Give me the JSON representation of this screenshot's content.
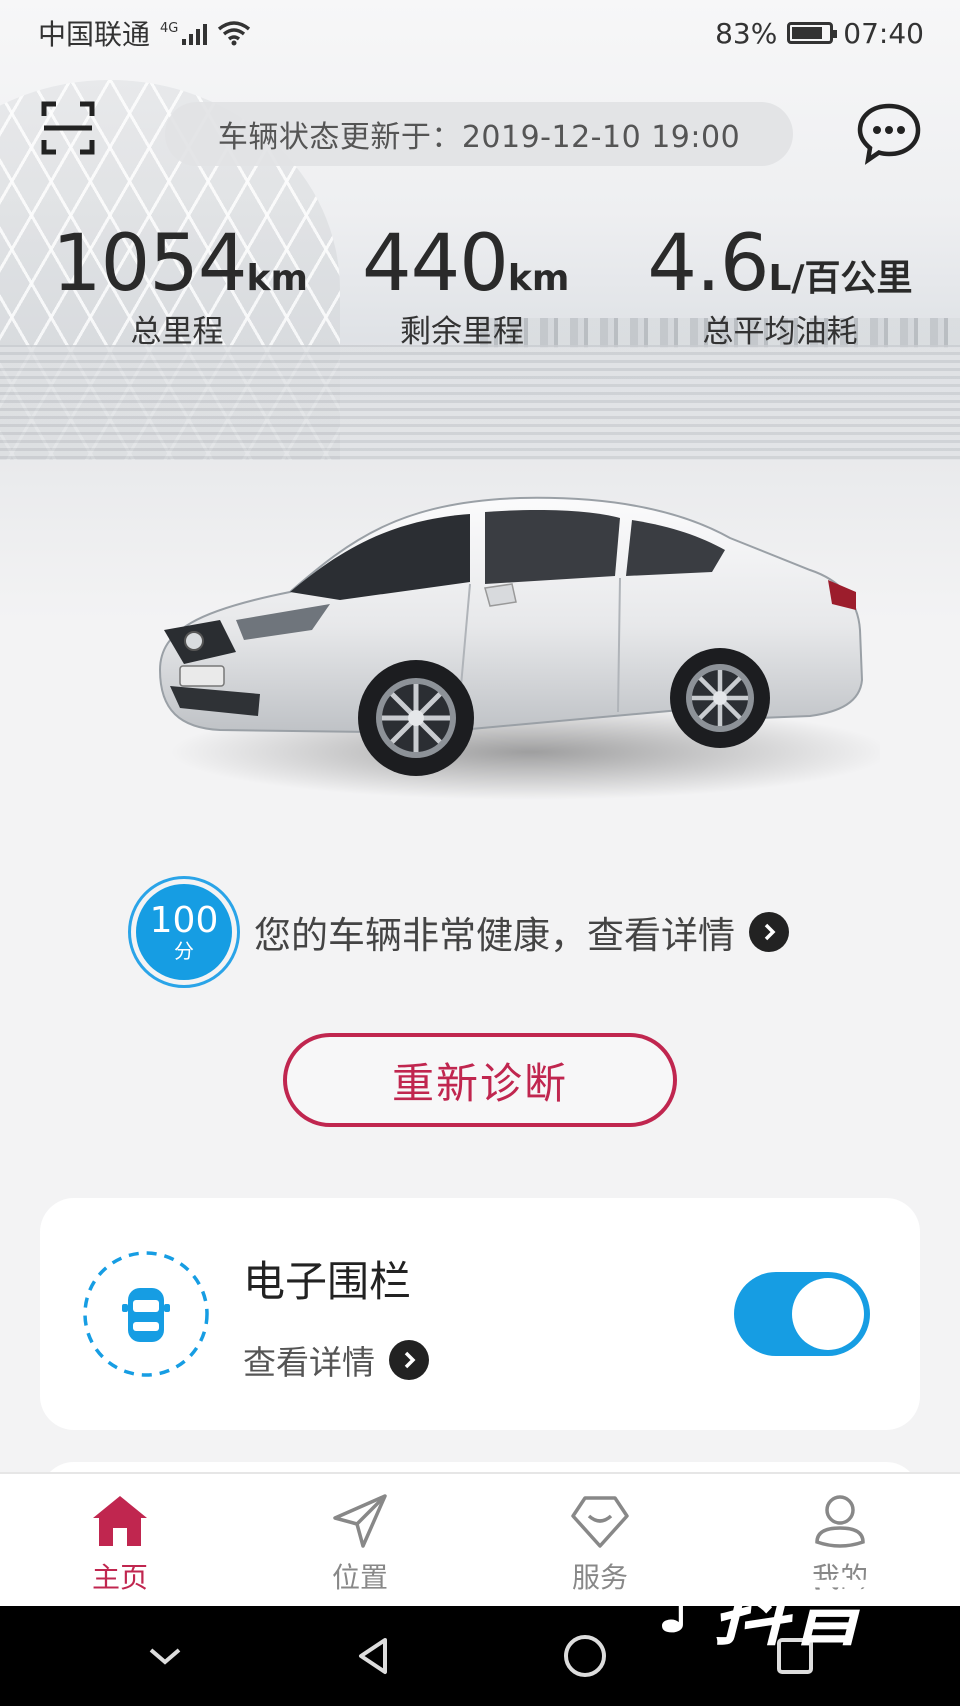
{
  "status_bar": {
    "carrier": "中国联通",
    "network": "4G",
    "battery": "83%",
    "battery_level": 0.83,
    "time": "07:40"
  },
  "header": {
    "update_text": "车辆状态更新于：2019-12-10 19:00"
  },
  "stats": [
    {
      "value": "1054",
      "unit": "km",
      "label": "总里程"
    },
    {
      "value": "440",
      "unit": "km",
      "label": "剩余里程"
    },
    {
      "value": "4.6",
      "unit": "L/百公里",
      "label": "总平均油耗"
    }
  ],
  "health": {
    "score": "100",
    "score_unit": "分",
    "message": "您的车辆非常健康，查看详情"
  },
  "rediagnose_label": "重新诊断",
  "geofence_card": {
    "title": "电子围栏",
    "link": "查看详情",
    "enabled": true
  },
  "bottom_nav": [
    {
      "label": "主页",
      "icon": "home-icon",
      "active": true
    },
    {
      "label": "位置",
      "icon": "location-arrow-icon",
      "active": false
    },
    {
      "label": "服务",
      "icon": "service-icon",
      "active": false
    },
    {
      "label": "我的",
      "icon": "profile-icon",
      "active": false
    }
  ],
  "colors": {
    "accent_red": "#c0264f",
    "accent_blue": "#169de3"
  },
  "watermark": "抖音"
}
